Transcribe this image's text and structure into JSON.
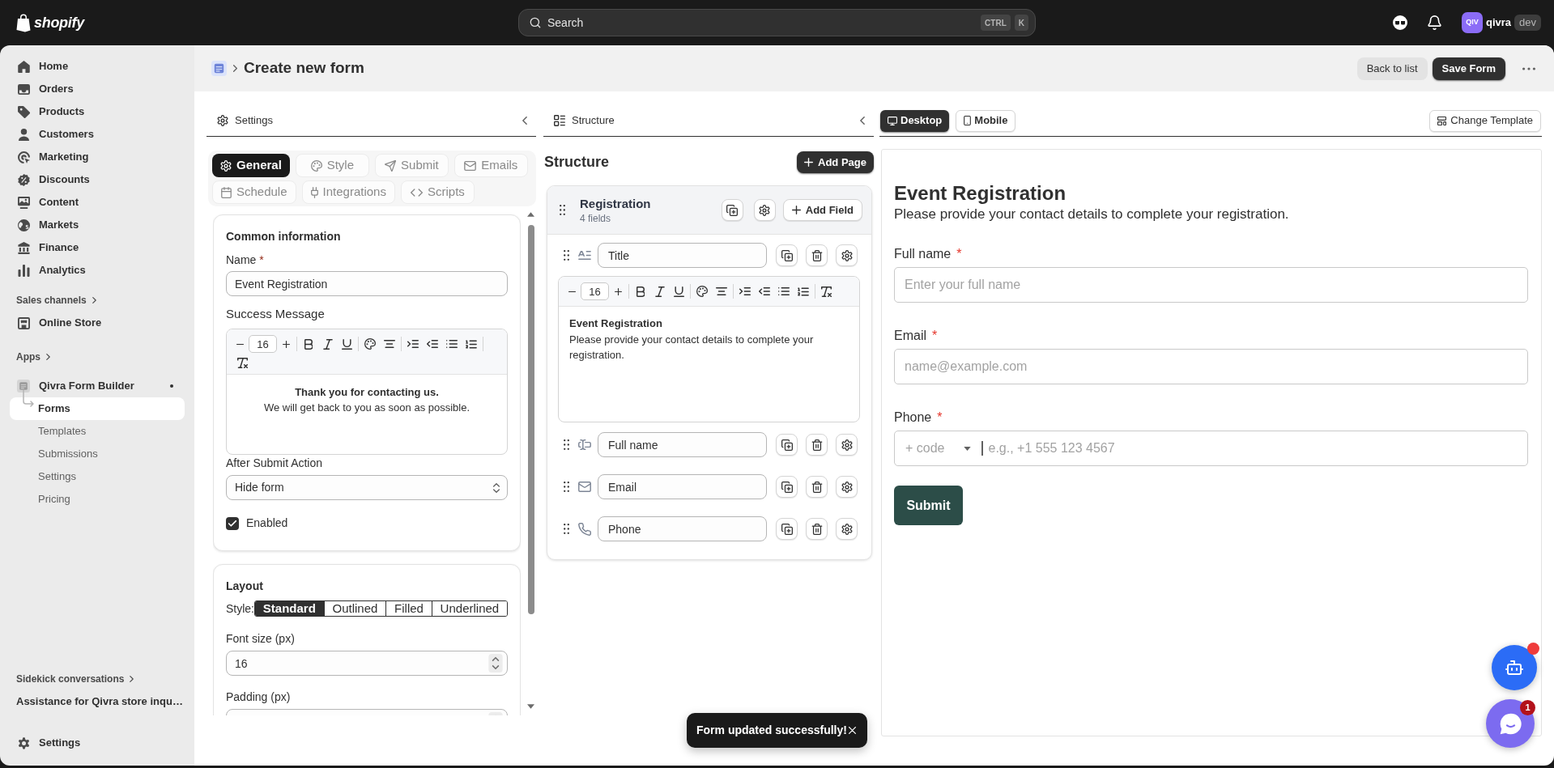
{
  "top_bar": {
    "logo": "shopify",
    "search": {
      "placeholder": "Search",
      "shortcut": [
        "CTRL",
        "K"
      ]
    },
    "account": {
      "initials": "QIV",
      "name": "qivra",
      "badge": "dev"
    }
  },
  "sidebar": {
    "items": [
      {
        "label": "Home",
        "selected": false
      },
      {
        "label": "Orders",
        "selected": false
      },
      {
        "label": "Products",
        "selected": false
      },
      {
        "label": "Customers",
        "selected": false
      },
      {
        "label": "Marketing",
        "selected": false
      },
      {
        "label": "Discounts",
        "selected": false
      },
      {
        "label": "Content",
        "selected": false
      },
      {
        "label": "Markets",
        "selected": false
      },
      {
        "label": "Finance",
        "selected": false
      },
      {
        "label": "Analytics",
        "selected": false
      }
    ],
    "sales_channels": {
      "heading": "Sales channels",
      "items": [
        {
          "label": "Online Store",
          "selected": false
        }
      ]
    },
    "apps": {
      "heading": "Apps",
      "items": [
        {
          "label": "Qivra Form Builder",
          "expanded": true,
          "children": [
            {
              "label": "Forms",
              "selected": true
            },
            {
              "label": "Templates",
              "selected": false
            },
            {
              "label": "Submissions",
              "selected": false
            },
            {
              "label": "Settings",
              "selected": false
            },
            {
              "label": "Pricing",
              "selected": false
            }
          ]
        }
      ]
    },
    "sidekick": {
      "heading": "Sidekick conversations",
      "items": [
        {
          "label": "Assistance for Qivra store inqu…",
          "selected": false
        }
      ]
    },
    "footer": {
      "label": "Settings",
      "selected": false
    }
  },
  "page_header": {
    "title": "Create new form",
    "buttons": [
      {
        "label": "Back to list",
        "kind": "secondary"
      },
      {
        "label": "Save Form",
        "kind": "primary"
      }
    ]
  },
  "settings_panel": {
    "title": "Settings",
    "tabs": [
      {
        "label": "General",
        "selected": true
      },
      {
        "label": "Style",
        "selected": false
      },
      {
        "label": "Submit",
        "selected": false
      },
      {
        "label": "Emails",
        "selected": false
      },
      {
        "label": "Schedule",
        "selected": false
      },
      {
        "label": "Integrations",
        "selected": false
      },
      {
        "label": "Scripts",
        "selected": false
      }
    ],
    "common_information": {
      "heading": "Common information",
      "name": {
        "label": "Name",
        "required_mark": "*",
        "value": "Event Registration"
      },
      "success_message": {
        "label": "Success Message",
        "font_size": "16",
        "content": [
          {
            "text": "Thank you for contacting us.",
            "bold": true
          },
          {
            "text": "We will get back to you as soon as possible.",
            "bold": false
          }
        ]
      },
      "after_submit_action": {
        "label": "After Submit Action",
        "value": "Hide form"
      },
      "enabled": {
        "label": "Enabled",
        "checked": true
      }
    },
    "layout": {
      "heading": "Layout",
      "style": {
        "label": "Style:",
        "options": [
          {
            "label": "Standard",
            "selected": true
          },
          {
            "label": "Outlined",
            "selected": false
          },
          {
            "label": "Filled",
            "selected": false
          },
          {
            "label": "Underlined",
            "selected": false
          }
        ]
      },
      "font_size": {
        "label": "Font size (px)",
        "value": "16"
      },
      "padding": {
        "label": "Padding (px)"
      }
    }
  },
  "structure_panel": {
    "title": "Structure",
    "heading": "Structure",
    "add_page_button": "Add Page",
    "pages": [
      {
        "title": "Registration",
        "field_count": "4 fields",
        "add_field_button": "Add Field",
        "fields": [
          {
            "kind": "title",
            "label": "Title",
            "editor": {
              "font_size": "16",
              "content": [
                {
                  "text": "Event Registration",
                  "bold": true
                },
                {
                  "text": "Please provide your contact details to complete your registration.",
                  "bold": false
                }
              ]
            }
          },
          {
            "kind": "text",
            "label": "Full name"
          },
          {
            "kind": "email",
            "label": "Email"
          },
          {
            "kind": "phone",
            "label": "Phone"
          }
        ]
      }
    ]
  },
  "preview_panel": {
    "devices": [
      {
        "label": "Desktop",
        "selected": true
      },
      {
        "label": "Mobile",
        "selected": false
      }
    ],
    "change_template_button": "Change Template",
    "form": {
      "title": "Event Registration",
      "description": "Please provide your contact details to complete your registration.",
      "fields": [
        {
          "kind": "text",
          "label": "Full name",
          "required_mark": "*",
          "placeholder": "Enter your full name"
        },
        {
          "kind": "email",
          "label": "Email",
          "required_mark": "*",
          "placeholder": "name@example.com"
        },
        {
          "kind": "phone",
          "label": "Phone",
          "required_mark": "*",
          "code_placeholder": "+ code",
          "placeholder": "e.g., +1 555 123 4567"
        }
      ],
      "submit_button": "Submit"
    }
  },
  "toast": {
    "message": "Form updated successfully!"
  },
  "chat_widget": {
    "badge": "1"
  }
}
